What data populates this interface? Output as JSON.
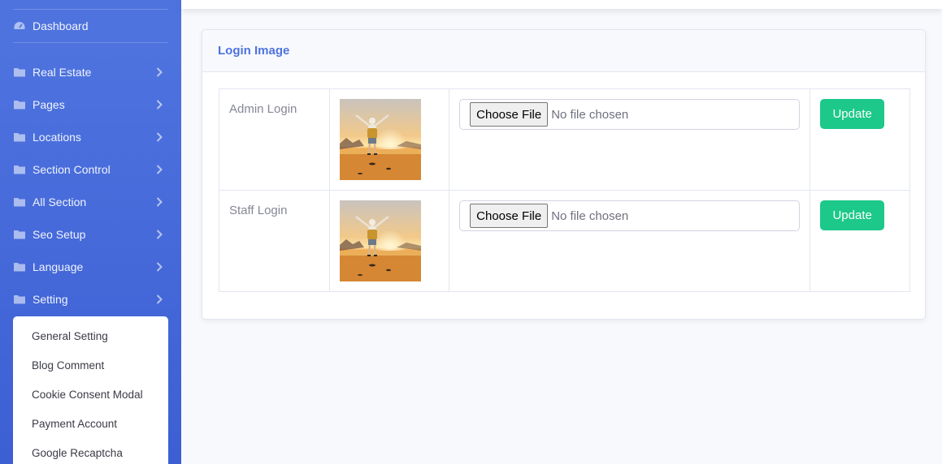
{
  "colors": {
    "primary": "#4e73df",
    "success": "#1cc88a",
    "sidebar_bg": "#4e73df",
    "text_muted": "#858796"
  },
  "sidebar": {
    "dashboard": {
      "label": "Dashboard",
      "icon": "tachometer-icon"
    },
    "items": [
      {
        "label": "Real Estate",
        "icon": "folder-icon"
      },
      {
        "label": "Pages",
        "icon": "folder-icon"
      },
      {
        "label": "Locations",
        "icon": "folder-icon"
      },
      {
        "label": "Section Control",
        "icon": "folder-icon"
      },
      {
        "label": "All Section",
        "icon": "folder-icon"
      },
      {
        "label": "Seo Setup",
        "icon": "folder-icon"
      },
      {
        "label": "Language",
        "icon": "folder-icon"
      },
      {
        "label": "Setting",
        "icon": "folder-icon"
      }
    ],
    "submenu": [
      "General Setting",
      "Blog Comment",
      "Cookie Consent Modal",
      "Payment Account",
      "Google Recaptcha"
    ]
  },
  "card": {
    "title": "Login Image",
    "rows": [
      {
        "label": "Admin Login",
        "choose_label": "Choose File",
        "file_status": "No file chosen",
        "button": "Update"
      },
      {
        "label": "Staff Login",
        "choose_label": "Choose File",
        "file_status": "No file chosen",
        "button": "Update"
      }
    ]
  }
}
